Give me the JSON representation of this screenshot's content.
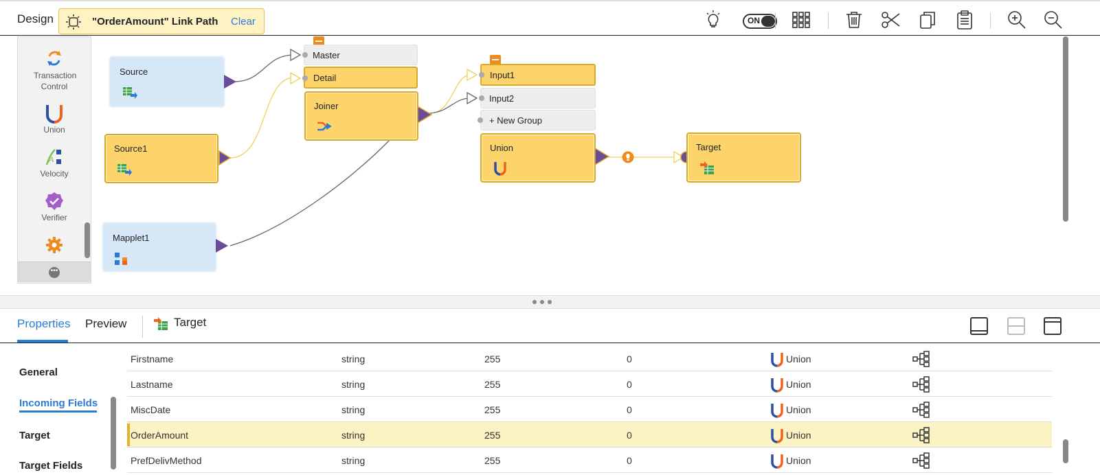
{
  "topbar": {
    "design_label": "Design",
    "link_path_title": "\"OrderAmount\" Link Path",
    "clear_label": "Clear",
    "toggle_label": "ON",
    "toggle_state": "on",
    "icons": [
      "lightbulb-icon",
      "grid-icon",
      "trash-icon",
      "scissors-icon",
      "copy-icon",
      "paste-icon",
      "zoom-in-icon",
      "zoom-out-icon"
    ]
  },
  "palette": {
    "items": [
      {
        "label": "Transaction Control",
        "icon": "transaction-control-icon"
      },
      {
        "label": "Union",
        "icon": "union-icon"
      },
      {
        "label": "Velocity",
        "icon": "velocity-icon"
      },
      {
        "label": "Verifier",
        "icon": "verifier-icon"
      },
      {
        "label": "",
        "icon": "gear-icon"
      }
    ],
    "more_icon": "more-icon"
  },
  "canvas": {
    "nodes": {
      "source": "Source",
      "source1": "Source1",
      "mapplet1": "Mapplet1",
      "joiner": "Joiner",
      "union": "Union",
      "target": "Target"
    },
    "joiner_groups": [
      "Master",
      "Detail"
    ],
    "union_groups": [
      "Input1",
      "Input2",
      "+ New Group"
    ]
  },
  "bottom": {
    "tabs": [
      "Properties",
      "Preview"
    ],
    "active_tab": "Properties",
    "selected_object": "Target",
    "nav": [
      "General",
      "Incoming Fields",
      "Target",
      "Target Fields"
    ],
    "active_nav": "Incoming Fields",
    "fields": [
      {
        "name": "Firstname",
        "type": "string",
        "precision": "255",
        "scale": "0",
        "origin": "Union"
      },
      {
        "name": "Lastname",
        "type": "string",
        "precision": "255",
        "scale": "0",
        "origin": "Union"
      },
      {
        "name": "MiscDate",
        "type": "string",
        "precision": "255",
        "scale": "0",
        "origin": "Union"
      },
      {
        "name": "OrderAmount",
        "type": "string",
        "precision": "255",
        "scale": "0",
        "origin": "Union"
      },
      {
        "name": "PrefDelivMethod",
        "type": "string",
        "precision": "255",
        "scale": "0",
        "origin": "Union"
      }
    ],
    "selected_field": "OrderAmount"
  },
  "colors": {
    "accent": "#2a7bd6",
    "node_gold": "#fcd46b",
    "node_blue": "#d6e8f8",
    "port_purple": "#6b4c9a",
    "collapse_orange": "#f08a1b",
    "selected_row": "#fcf3c4"
  }
}
